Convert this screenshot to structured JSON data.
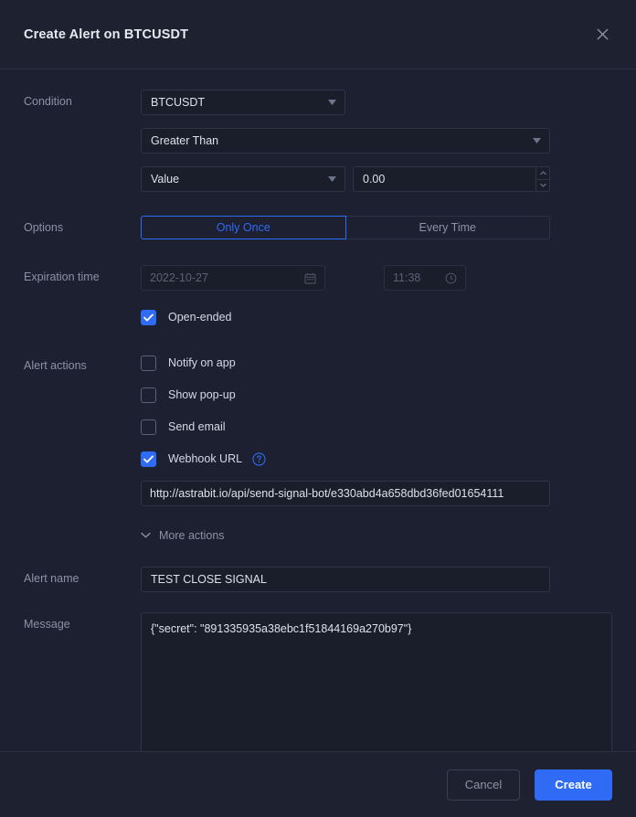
{
  "header": {
    "title": "Create Alert on BTCUSDT",
    "close_icon": "close-icon"
  },
  "condition": {
    "label": "Condition",
    "symbol": "BTCUSDT",
    "operator": "Greater Than",
    "value_type": "Value",
    "value": "0.00"
  },
  "options": {
    "label": "Options",
    "only_once": "Only Once",
    "every_time": "Every Time",
    "selected": "Only Once"
  },
  "expiration": {
    "label": "Expiration time",
    "date": "2022-10-27",
    "time": "11:38",
    "open_ended_label": "Open-ended",
    "open_ended_checked": true
  },
  "alert_actions": {
    "label": "Alert actions",
    "items": [
      {
        "label": "Notify on app",
        "checked": false
      },
      {
        "label": "Show pop-up",
        "checked": false
      },
      {
        "label": "Send email",
        "checked": false
      },
      {
        "label": "Webhook URL",
        "checked": true
      }
    ],
    "webhook_url": "http://astrabit.io/api/send-signal-bot/e330abd4a658dbd36fed01654111",
    "more_actions": "More actions"
  },
  "alert_name": {
    "label": "Alert name",
    "value": "TEST CLOSE SIGNAL"
  },
  "message": {
    "label": "Message",
    "value": "{\"secret\": \"891335935a38ebc1f51844169a270b97\"}"
  },
  "footer": {
    "cancel": "Cancel",
    "create": "Create"
  },
  "colors": {
    "accent": "#2f6bf5",
    "panel": "#1c2030",
    "header": "#1e2230",
    "field": "#1a1e2b",
    "border": "#2e3447",
    "text": "#d6dae6",
    "muted": "#8b92a5",
    "disabled": "#5b6276"
  }
}
